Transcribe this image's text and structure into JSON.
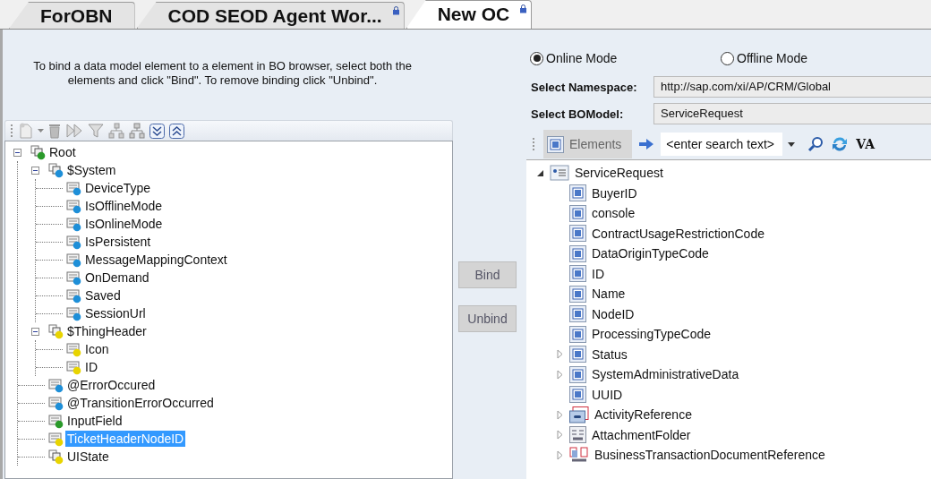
{
  "tabs": [
    {
      "label": "ForOBN",
      "selected": false,
      "locked": false
    },
    {
      "label": "COD SEOD Agent Wor...",
      "selected": false,
      "locked": true
    },
    {
      "label": "New OC",
      "selected": true,
      "locked": true
    }
  ],
  "instruction": "To bind a data model element to a element in BO browser, select both the\nelements and click \"Bind\". To remove binding click \"Unbind\".",
  "data_tree": [
    {
      "label": "Root",
      "kind": "group",
      "color": "#2a9a2a",
      "selected": false,
      "expanded": true,
      "children": [
        {
          "label": "$System",
          "kind": "group",
          "color": "#1e8fd8",
          "selected": false,
          "expanded": true,
          "children": [
            {
              "label": "DeviceType",
              "kind": "field",
              "color": "#1e8fd8",
              "selected": false
            },
            {
              "label": "IsOfflineMode",
              "kind": "field",
              "color": "#1e8fd8",
              "selected": false
            },
            {
              "label": "IsOnlineMode",
              "kind": "field",
              "color": "#1e8fd8",
              "selected": false
            },
            {
              "label": "IsPersistent",
              "kind": "field",
              "color": "#1e8fd8",
              "selected": false
            },
            {
              "label": "MessageMappingContext",
              "kind": "field",
              "color": "#1e8fd8",
              "selected": false
            },
            {
              "label": "OnDemand",
              "kind": "field",
              "color": "#1e8fd8",
              "selected": false
            },
            {
              "label": "Saved",
              "kind": "field",
              "color": "#1e8fd8",
              "selected": false
            },
            {
              "label": "SessionUrl",
              "kind": "field",
              "color": "#1e8fd8",
              "selected": false
            }
          ]
        },
        {
          "label": "$ThingHeader",
          "kind": "group",
          "color": "#e8d400",
          "selected": false,
          "expanded": true,
          "children": [
            {
              "label": "Icon",
              "kind": "field",
              "color": "#e8d400",
              "selected": false
            },
            {
              "label": "ID",
              "kind": "field",
              "color": "#e8d400",
              "selected": false
            }
          ]
        },
        {
          "label": "@ErrorOccured",
          "kind": "field",
          "color": "#1e8fd8",
          "selected": false
        },
        {
          "label": "@TransitionErrorOccurred",
          "kind": "field",
          "color": "#1e8fd8",
          "selected": false
        },
        {
          "label": "InputField",
          "kind": "field",
          "color": "#2a9a2a",
          "selected": false
        },
        {
          "label": "TicketHeaderNodeID",
          "kind": "field",
          "color": "#e8d400",
          "selected": true
        },
        {
          "label": "UIState",
          "kind": "group",
          "color": "#e8d400",
          "selected": false
        }
      ]
    }
  ],
  "buttons": [
    {
      "label": "Bind"
    },
    {
      "label": "Unbind"
    }
  ],
  "mode": [
    {
      "label": "Online Mode",
      "selected": true
    },
    {
      "label": "Offline Mode",
      "selected": false
    }
  ],
  "fields": [
    {
      "label": "Select Namespace:",
      "value": "http://sap.com/xi/AP/CRM/Global"
    },
    {
      "label": "Select BOModel:",
      "value": "ServiceRequest"
    }
  ],
  "bo_toolbar": {
    "elements_button": "Elements",
    "search": {
      "placeholder": "<enter search text>"
    },
    "va_button": "VA"
  },
  "bo_tree": [
    {
      "label": "ServiceRequest",
      "kind": "node",
      "expanded": true,
      "children": [
        {
          "label": "BuyerID",
          "kind": "element"
        },
        {
          "label": "console",
          "kind": "element"
        },
        {
          "label": "ContractUsageRestrictionCode",
          "kind": "element"
        },
        {
          "label": "DataOriginTypeCode",
          "kind": "element"
        },
        {
          "label": "ID",
          "kind": "element"
        },
        {
          "label": "Name",
          "kind": "element"
        },
        {
          "label": "NodeID",
          "kind": "element"
        },
        {
          "label": "ProcessingTypeCode",
          "kind": "element"
        },
        {
          "label": "Status",
          "kind": "element",
          "expanded": false
        },
        {
          "label": "SystemAdministrativeData",
          "kind": "element",
          "expanded": false
        },
        {
          "label": "UUID",
          "kind": "element"
        },
        {
          "label": "ActivityReference",
          "kind": "association",
          "expanded": false
        },
        {
          "label": "AttachmentFolder",
          "kind": "folder",
          "expanded": false
        },
        {
          "label": "BusinessTransactionDocumentReference",
          "kind": "link",
          "expanded": false
        }
      ]
    }
  ]
}
